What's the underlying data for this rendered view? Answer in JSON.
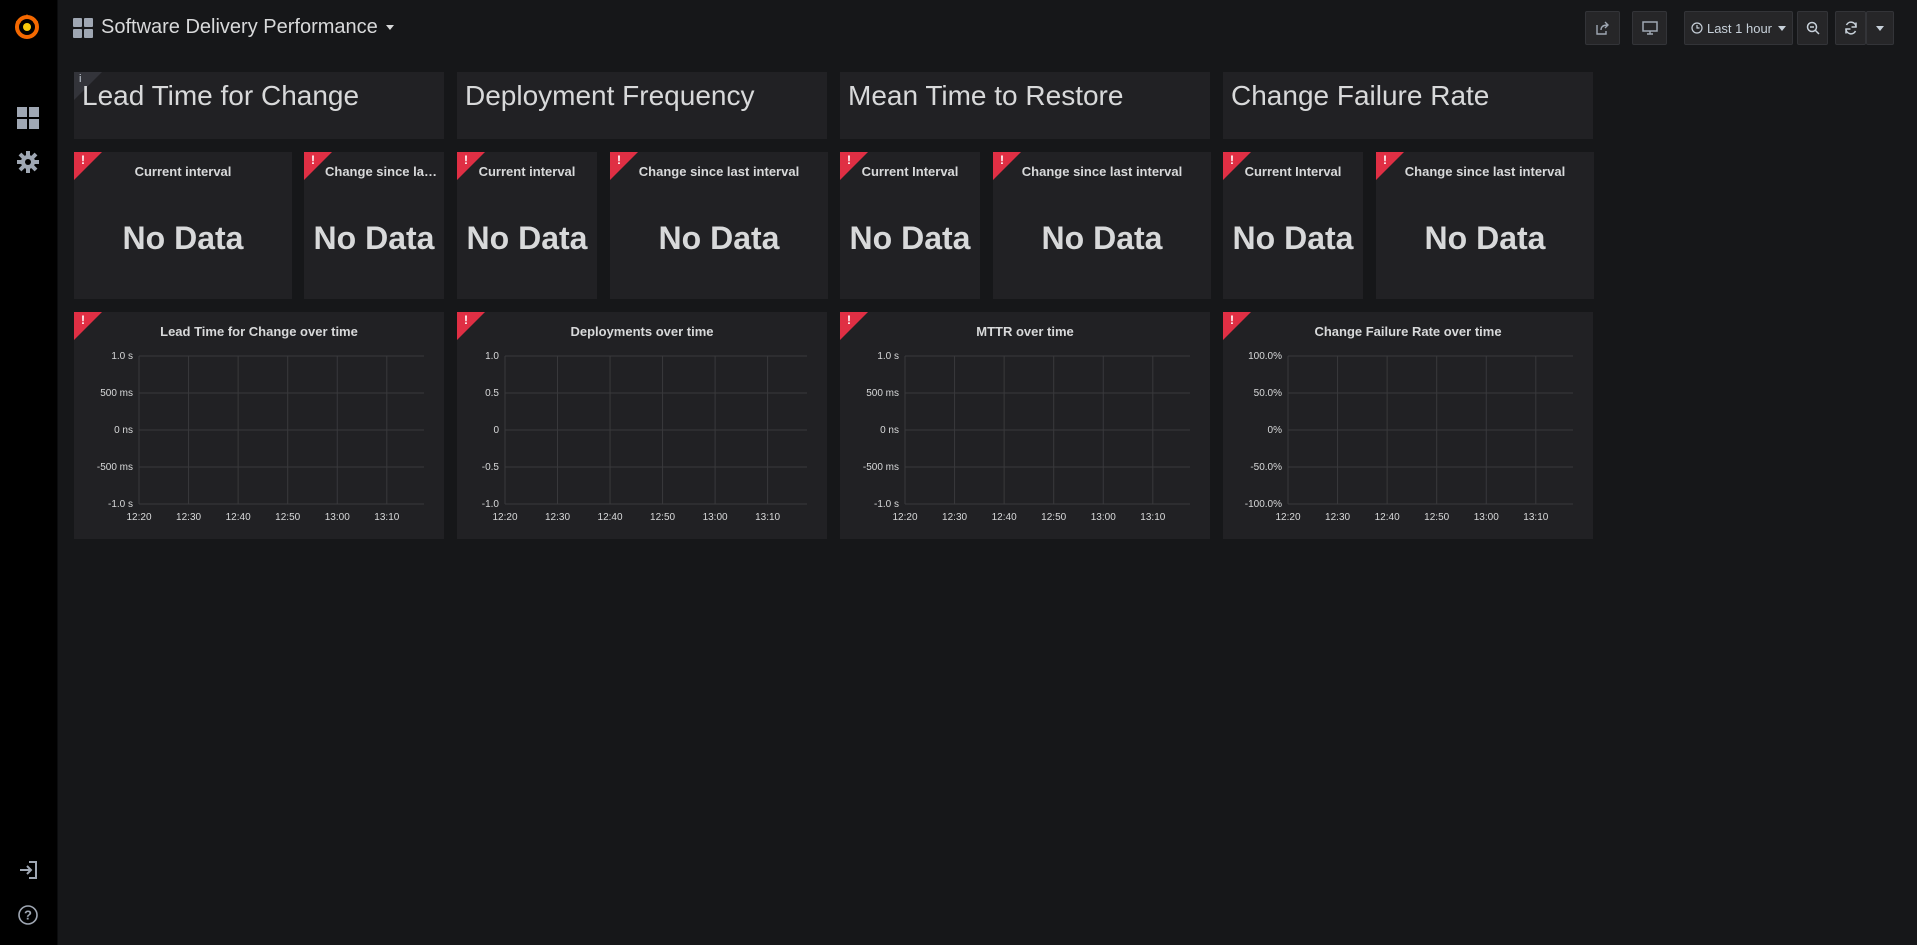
{
  "sidebar": {
    "logo_icon": "grafana-logo-icon",
    "items": [
      {
        "name": "dashboards-icon"
      },
      {
        "name": "configuration-gear-icon"
      }
    ],
    "bottom_items": [
      {
        "name": "sign-in-icon"
      },
      {
        "name": "help-icon"
      }
    ]
  },
  "header": {
    "title": "Software Delivery Performance",
    "time_range": "Last 1 hour"
  },
  "rows": {
    "sections": [
      {
        "title": "Lead Time for Change"
      },
      {
        "title": "Deployment Frequency"
      },
      {
        "title": "Mean Time to Restore"
      },
      {
        "title": "Change Failure Rate"
      }
    ],
    "stats": [
      {
        "title": "Current interval",
        "value": "No Data"
      },
      {
        "title": "Change since la…",
        "value": "No Data"
      },
      {
        "title": "Current interval",
        "value": "No Data"
      },
      {
        "title": "Change since last interval",
        "value": "No Data"
      },
      {
        "title": "Current Interval",
        "value": "No Data"
      },
      {
        "title": "Change since last interval",
        "value": "No Data"
      },
      {
        "title": "Current Interval",
        "value": "No Data"
      },
      {
        "title": "Change since last interval",
        "value": "No Data"
      }
    ],
    "graphs": [
      {
        "title": "Lead Time for Change over time",
        "yticks": [
          "1.0 s",
          "500 ms",
          "0 ns",
          "-500 ms",
          "-1.0 s"
        ]
      },
      {
        "title": "Deployments over time",
        "yticks": [
          "1.0",
          "0.5",
          "0",
          "-0.5",
          "-1.0"
        ]
      },
      {
        "title": "MTTR over time",
        "yticks": [
          "1.0 s",
          "500 ms",
          "0 ns",
          "-500 ms",
          "-1.0 s"
        ]
      },
      {
        "title": "Change Failure Rate over time",
        "yticks": [
          "100.0%",
          "50.0%",
          "0%",
          "-50.0%",
          "-100.0%"
        ]
      }
    ],
    "xticks": [
      "12:20",
      "12:30",
      "12:40",
      "12:50",
      "13:00",
      "13:10"
    ]
  },
  "colors": {
    "error": "#e02f44",
    "panel_bg": "#212124",
    "page_bg": "#161719"
  }
}
